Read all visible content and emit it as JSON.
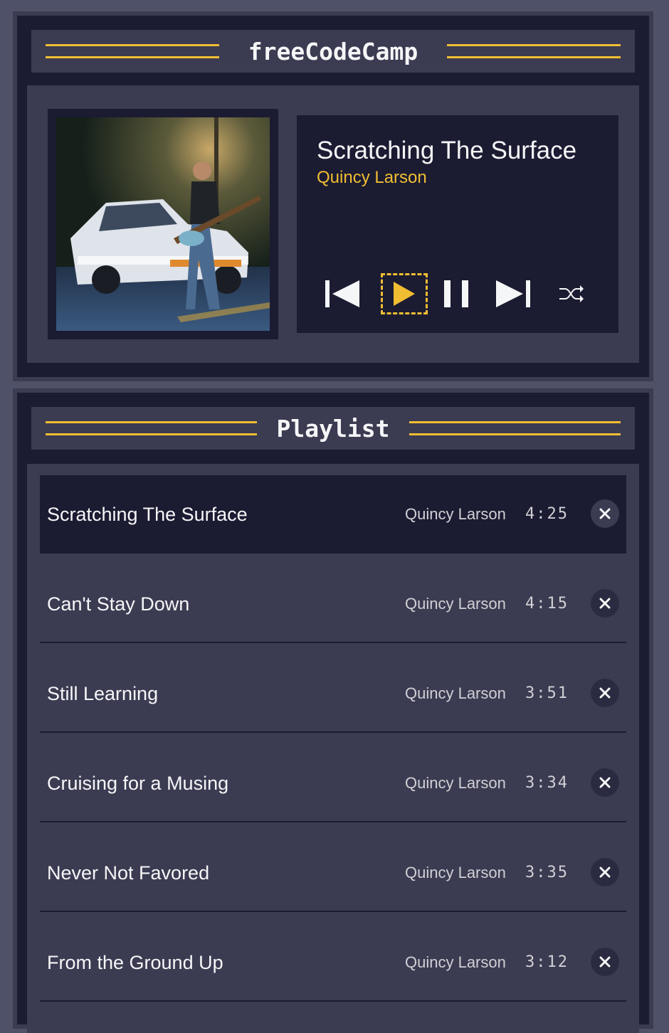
{
  "app": {
    "player_title": "freeCodeCamp",
    "playlist_title": "Playlist"
  },
  "now_playing": {
    "title": "Scratching The Surface",
    "artist": "Quincy Larson",
    "album_art": "guitarist-with-car-photo"
  },
  "controls": {
    "previous_icon": "skip-previous-icon",
    "play_icon": "play-icon",
    "pause_icon": "pause-icon",
    "next_icon": "skip-next-icon",
    "shuffle_icon": "shuffle-icon"
  },
  "playlist": [
    {
      "title": "Scratching The Surface",
      "artist": "Quincy Larson",
      "duration": "4:25",
      "active": true
    },
    {
      "title": "Can't Stay Down",
      "artist": "Quincy Larson",
      "duration": "4:15",
      "active": false
    },
    {
      "title": "Still Learning",
      "artist": "Quincy Larson",
      "duration": "3:51",
      "active": false
    },
    {
      "title": "Cruising for a Musing",
      "artist": "Quincy Larson",
      "duration": "3:34",
      "active": false
    },
    {
      "title": "Never Not Favored",
      "artist": "Quincy Larson",
      "duration": "3:35",
      "active": false
    },
    {
      "title": "From the Ground Up",
      "artist": "Quincy Larson",
      "duration": "3:12",
      "active": false
    }
  ],
  "colors": {
    "accent": "#f1be32",
    "dark": "#1b1b32",
    "panel": "#3b3b52",
    "text": "#f5f6f7"
  }
}
